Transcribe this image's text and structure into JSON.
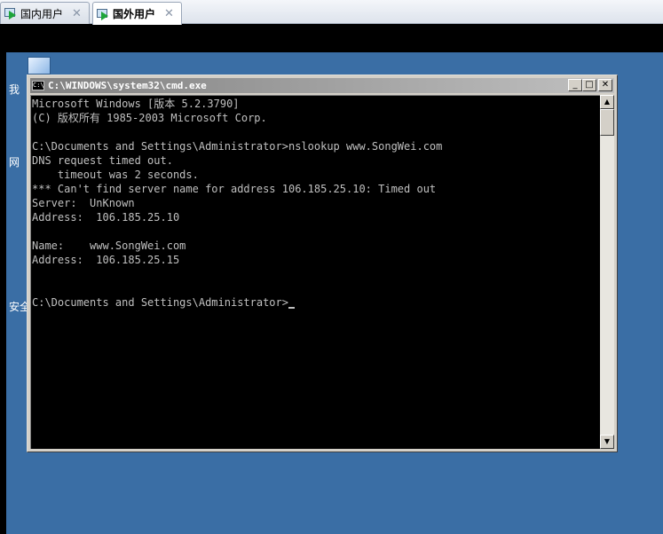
{
  "tabs": [
    {
      "label": "国内用户",
      "active": false,
      "close": "✕"
    },
    {
      "label": "国外用户",
      "active": true,
      "close": "✕"
    }
  ],
  "desktop": {
    "labels": [
      "我",
      "网",
      "安全"
    ]
  },
  "window": {
    "title": "C:\\WINDOWS\\system32\\cmd.exe",
    "icon_text": "C:\\",
    "buttons": {
      "minimize": "_",
      "maximize": "□",
      "close": "✕"
    }
  },
  "console": {
    "lines": [
      "Microsoft Windows [版本 5.2.3790]",
      "(C) 版权所有 1985-2003 Microsoft Corp.",
      "",
      "C:\\Documents and Settings\\Administrator>nslookup www.SongWei.com",
      "DNS request timed out.",
      "    timeout was 2 seconds.",
      "*** Can't find server name for address 106.185.25.10: Timed out",
      "Server:  UnKnown",
      "Address:  106.185.25.10",
      "",
      "Name:    www.SongWei.com",
      "Address:  106.185.25.15",
      "",
      "",
      "C:\\Documents and Settings\\Administrator>"
    ]
  },
  "scrollbar": {
    "up": "▲",
    "down": "▼"
  },
  "colors": {
    "desktop": "#3a6ea5",
    "console_bg": "#000000",
    "console_fg": "#c0c0c0",
    "tab_play_icon": "#1fa53a"
  }
}
